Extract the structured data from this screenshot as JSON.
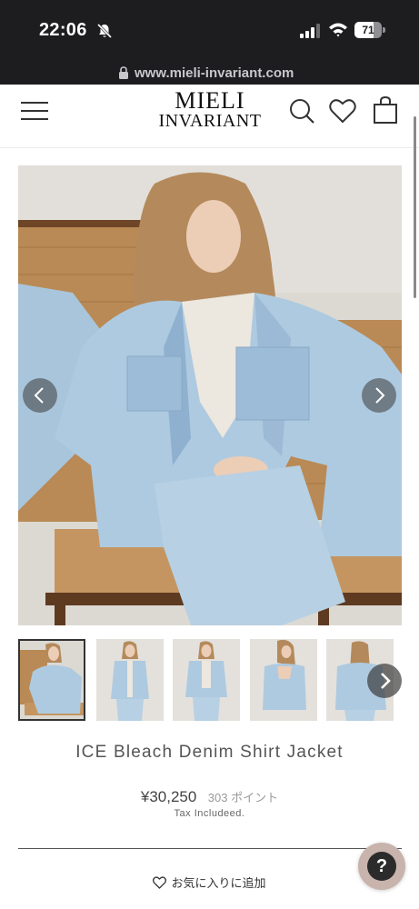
{
  "status_bar": {
    "time": "22:06",
    "battery_level": "71",
    "battery_fraction": 0.71,
    "icons": [
      "bell-slash-icon",
      "cellular-signal-icon",
      "wifi-icon",
      "battery-icon"
    ]
  },
  "browser": {
    "url": "www.mieli-invariant.com",
    "icons": [
      "lock-icon"
    ]
  },
  "header": {
    "logo_line1": "MIELI",
    "logo_line2": "INVARIANT",
    "icons": [
      "menu-icon",
      "search-icon",
      "heart-icon",
      "cart-icon"
    ]
  },
  "gallery": {
    "image_count": 5,
    "active_index": 0,
    "icons": [
      "chevron-left-icon",
      "chevron-right-icon"
    ]
  },
  "product": {
    "title": "ICE Bleach Denim Shirt Jacket",
    "price": "¥30,250",
    "points": "303 ポイント",
    "tax_note": "Tax Includeed."
  },
  "wishlist": {
    "label": "お気に入りに追加",
    "icon": "heart-outline-icon"
  },
  "help": {
    "label": "?"
  },
  "colors": {
    "status_bar_bg": "#1d1d1f",
    "denim": "#aecae0",
    "wall": "#d9d6d0",
    "rattan": "#b98a55",
    "help_button": "#c9b3ad"
  }
}
